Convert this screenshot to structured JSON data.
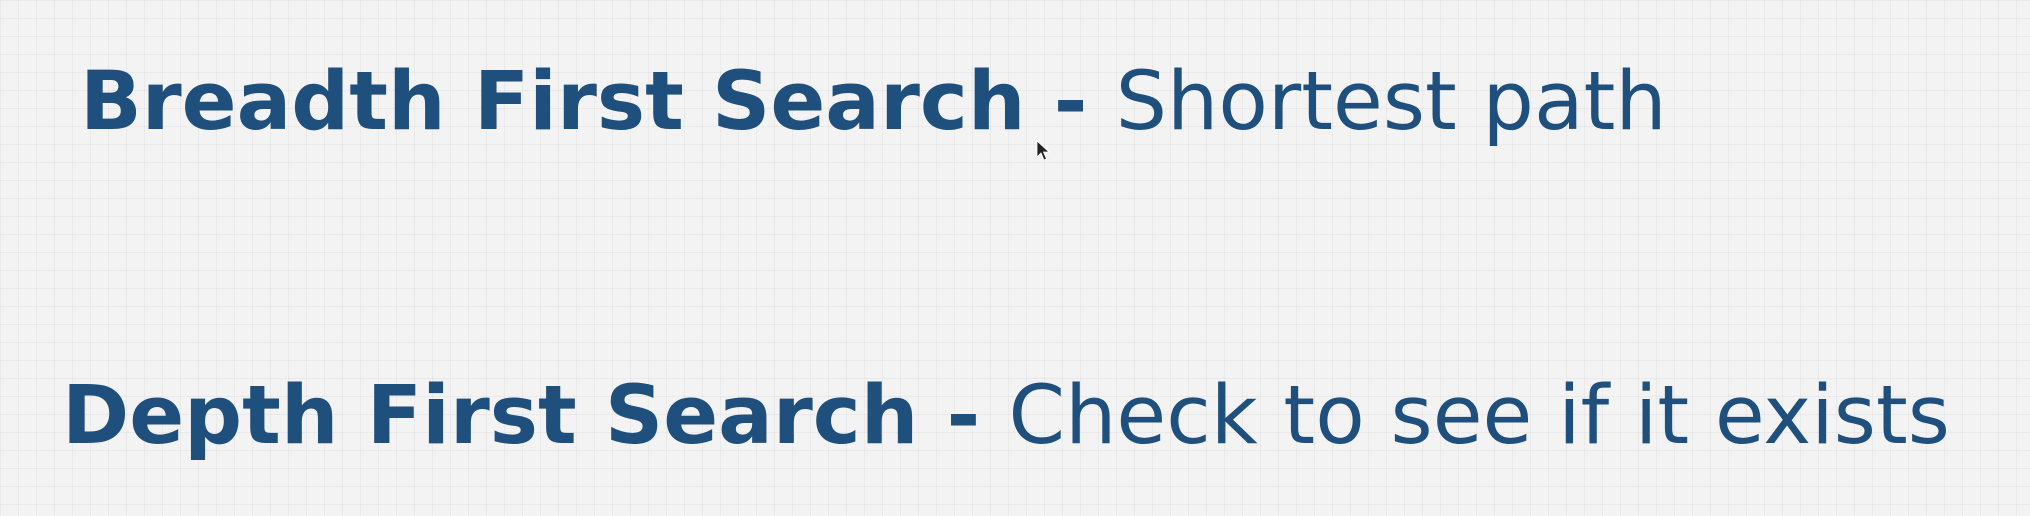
{
  "slide": {
    "items": [
      {
        "term": "Breadth First Search",
        "separator": " - ",
        "description": "Shortest path"
      },
      {
        "term": "Depth First Search",
        "separator": " - ",
        "description": "Check to see if it exists"
      }
    ],
    "colors": {
      "text": "#1f4f7c",
      "background": "#f3f3f3"
    }
  }
}
